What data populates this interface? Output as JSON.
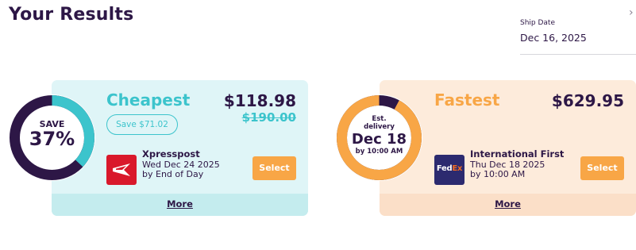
{
  "page_title": "Your Results",
  "ship_date": {
    "label": "Ship Date",
    "value": "Dec 16, 2025"
  },
  "colors": {
    "navy": "#2d1746",
    "teal": "#3cc4cc",
    "orange": "#f8a646",
    "cheap_card_bg": "#dff5f7",
    "fast_card_bg": "#fdebdb"
  },
  "cheapest": {
    "ring_label": "SAVE",
    "ring_value": "37%",
    "ring_fill_percent": 37,
    "label": "Cheapest",
    "price": "$118.98",
    "original_price": "$190.00",
    "savings_badge": "Save $71.02",
    "carrier_logo": "canada-post-logo-icon",
    "carrier": "Xpresspost",
    "delivery_date": "Wed Dec 24 2025",
    "delivery_time": "by End of Day",
    "select_label": "Select",
    "more_label": "More"
  },
  "fastest": {
    "ring_line1": "Est.",
    "ring_line2": "delivery",
    "ring_date": "Dec 18",
    "ring_time": "by 10:00 AM",
    "ring_fill_percent": 92,
    "label": "Fastest",
    "price": "$629.95",
    "carrier_logo": "fedex-logo-icon",
    "logo_text_fed": "Fed",
    "logo_text_ex": "Ex",
    "carrier": "International First",
    "delivery_date": "Thu Dec 18 2025",
    "delivery_time": "by 10:00 AM",
    "select_label": "Select",
    "more_label": "More"
  }
}
